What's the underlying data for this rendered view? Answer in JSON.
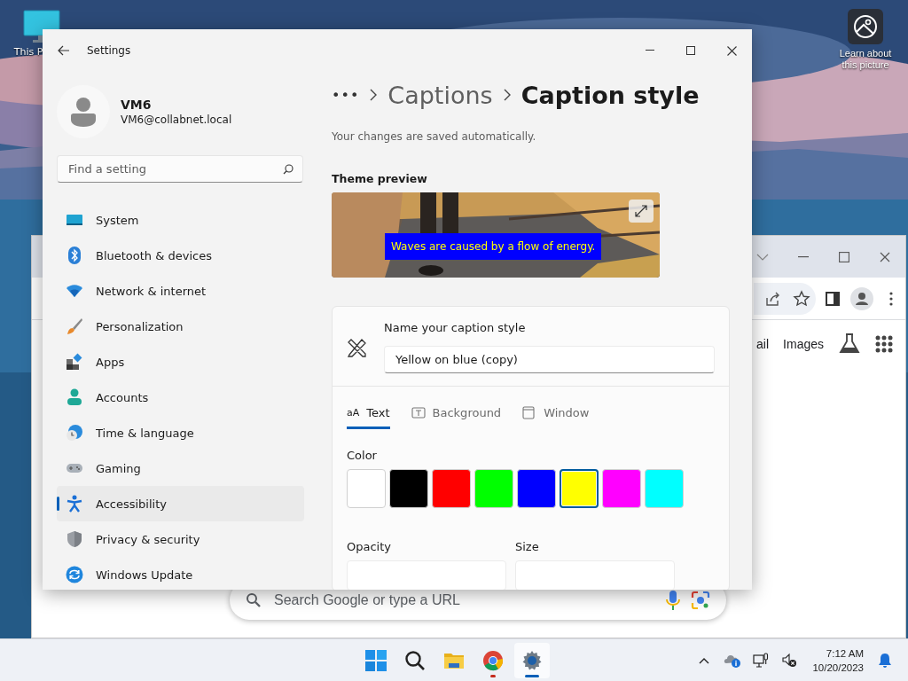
{
  "desktop": {
    "icons": [
      {
        "label": "This P"
      }
    ],
    "spotlight": {
      "label": "Learn about this picture"
    }
  },
  "browser_window": {
    "nav_links": [
      "ail",
      "Images"
    ],
    "search": {
      "placeholder": "Search Google or type a URL"
    }
  },
  "settings_window": {
    "title": "Settings",
    "user": {
      "name": "VM6",
      "email": "VM6@collabnet.local"
    },
    "search": {
      "placeholder": "Find a setting"
    },
    "nav": [
      {
        "label": "System",
        "selected": false
      },
      {
        "label": "Bluetooth & devices",
        "selected": false
      },
      {
        "label": "Network & internet",
        "selected": false
      },
      {
        "label": "Personalization",
        "selected": false
      },
      {
        "label": "Apps",
        "selected": false
      },
      {
        "label": "Accounts",
        "selected": false
      },
      {
        "label": "Time & language",
        "selected": false
      },
      {
        "label": "Gaming",
        "selected": false
      },
      {
        "label": "Accessibility",
        "selected": true
      },
      {
        "label": "Privacy & security",
        "selected": false
      },
      {
        "label": "Windows Update",
        "selected": false
      }
    ],
    "breadcrumb": [
      {
        "label": "•••",
        "kind": "overflow"
      },
      {
        "label": "Captions",
        "kind": "link"
      },
      {
        "label": "Caption style",
        "kind": "current"
      }
    ],
    "note": "Your changes are saved automatically.",
    "preview": {
      "heading": "Theme preview",
      "caption": "Waves are caused by a flow of energy."
    },
    "style_name": {
      "label": "Name your caption style",
      "value": "Yellow on blue (copy)"
    },
    "tabs": [
      {
        "label": "Text",
        "icon_text": "aA",
        "selected": true
      },
      {
        "label": "Background",
        "selected": false
      },
      {
        "label": "Window",
        "selected": false
      }
    ],
    "color": {
      "label": "Color",
      "swatches": [
        {
          "color": "#ffffff",
          "selected": false
        },
        {
          "color": "#000000",
          "selected": false
        },
        {
          "color": "#ff0000",
          "selected": false
        },
        {
          "color": "#00ff00",
          "selected": false
        },
        {
          "color": "#0000ff",
          "selected": false
        },
        {
          "color": "#ffff00",
          "selected": true
        },
        {
          "color": "#ff00ff",
          "selected": false
        },
        {
          "color": "#00ffff",
          "selected": false
        }
      ]
    },
    "opacity": {
      "label": "Opacity"
    },
    "size": {
      "label": "Size"
    }
  },
  "taskbar": {
    "apps": [
      {
        "active": false,
        "attention": false
      },
      {
        "active": false,
        "attention": false
      },
      {
        "active": false,
        "attention": false
      },
      {
        "active": false,
        "attention": true
      },
      {
        "active": true,
        "attention": false
      }
    ],
    "time": "7:12 AM",
    "date": "10/20/2023"
  }
}
